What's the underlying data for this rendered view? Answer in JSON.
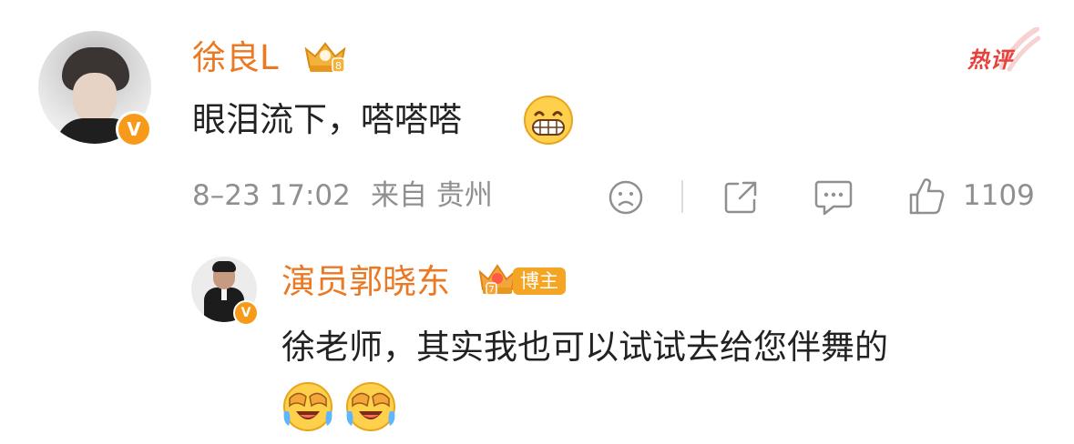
{
  "comment": {
    "user": {
      "name": "徐良L",
      "verified": "V",
      "crown_level": "8"
    },
    "hot_label": "热评",
    "text": "眼泪流下，嗒嗒嗒",
    "emoji": "grinning-face",
    "time": "8–23 17:02",
    "location": "来自 贵州",
    "actions": {
      "like_count": "1109"
    }
  },
  "reply": {
    "user": {
      "name": "演员郭晓东",
      "verified": "V",
      "crown_level": "7",
      "badge": "博主"
    },
    "text": "徐老师，其实我也可以试试去给您伴舞的",
    "emojis": [
      "laugh-cry-face",
      "laugh-cry-face"
    ]
  },
  "colors": {
    "username": "#eb7823",
    "hot": "#e8413b",
    "meta": "#8f8f8f",
    "badge": "#f5a524"
  }
}
